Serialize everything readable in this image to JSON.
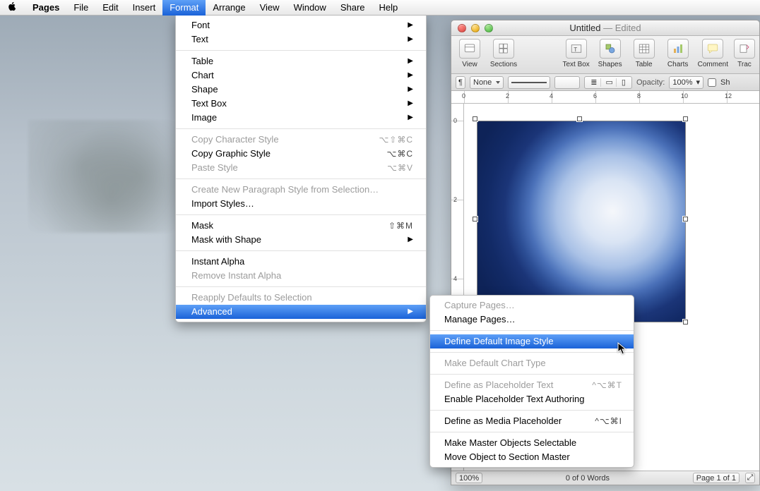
{
  "menubar": {
    "app_name": "Pages",
    "items": [
      "File",
      "Edit",
      "Insert",
      "Format",
      "Arrange",
      "View",
      "Window",
      "Share",
      "Help"
    ],
    "active_index": 3
  },
  "format_menu": {
    "groups": [
      [
        {
          "label": "Font",
          "submenu": true
        },
        {
          "label": "Text",
          "submenu": true
        }
      ],
      [
        {
          "label": "Table",
          "submenu": true
        },
        {
          "label": "Chart",
          "submenu": true
        },
        {
          "label": "Shape",
          "submenu": true
        },
        {
          "label": "Text Box",
          "submenu": true
        },
        {
          "label": "Image",
          "submenu": true
        }
      ],
      [
        {
          "label": "Copy Character Style",
          "shortcut": "⌥⇧⌘C",
          "disabled": true
        },
        {
          "label": "Copy Graphic Style",
          "shortcut": "⌥⌘C"
        },
        {
          "label": "Paste Style",
          "shortcut": "⌥⌘V",
          "disabled": true
        }
      ],
      [
        {
          "label": "Create New Paragraph Style from Selection…",
          "disabled": true
        },
        {
          "label": "Import Styles…"
        }
      ],
      [
        {
          "label": "Mask",
          "shortcut": "⇧⌘M"
        },
        {
          "label": "Mask with Shape",
          "submenu": true
        }
      ],
      [
        {
          "label": "Instant Alpha"
        },
        {
          "label": "Remove Instant Alpha",
          "disabled": true
        }
      ],
      [
        {
          "label": "Reapply Defaults to Selection",
          "disabled": true
        },
        {
          "label": "Advanced",
          "submenu": true,
          "highlighted": true
        }
      ]
    ]
  },
  "advanced_submenu": {
    "groups": [
      [
        {
          "label": "Capture Pages…",
          "disabled": true
        },
        {
          "label": "Manage Pages…"
        }
      ],
      [
        {
          "label": "Define Default Image Style",
          "highlighted": true
        }
      ],
      [
        {
          "label": "Make Default Chart Type",
          "disabled": true
        }
      ],
      [
        {
          "label": "Define as Placeholder Text",
          "shortcut": "^⌥⌘T",
          "disabled": true
        },
        {
          "label": "Enable Placeholder Text Authoring"
        }
      ],
      [
        {
          "label": "Define as Media Placeholder",
          "shortcut": "^⌥⌘I"
        }
      ],
      [
        {
          "label": "Make Master Objects Selectable"
        },
        {
          "label": "Move Object to Section Master"
        }
      ]
    ]
  },
  "window": {
    "title": "Untitled",
    "edited_suffix": " — Edited",
    "toolbar": {
      "left": [
        {
          "name": "view-icon",
          "label": "View"
        },
        {
          "name": "sections-icon",
          "label": "Sections"
        }
      ],
      "right": [
        {
          "name": "text-box-icon",
          "label": "Text Box"
        },
        {
          "name": "shapes-icon",
          "label": "Shapes"
        },
        {
          "name": "table-icon",
          "label": "Table"
        },
        {
          "name": "charts-icon",
          "label": "Charts"
        },
        {
          "name": "comment-icon",
          "label": "Comment"
        },
        {
          "name": "track-icon",
          "label": "Trac"
        }
      ]
    },
    "formatbar": {
      "style_label": "None",
      "opacity_label": "Opacity:",
      "opacity_value": "100%",
      "shadow_checkbox_label": "Sh"
    },
    "ruler_top_numbers": [
      "0",
      "2",
      "4",
      "6",
      "8",
      "10",
      "12"
    ],
    "ruler_left_numbers": [
      "0",
      "2",
      "4"
    ],
    "statusbar": {
      "zoom": "100%",
      "words": "0 of 0 Words",
      "page": "Page 1 of 1"
    }
  }
}
